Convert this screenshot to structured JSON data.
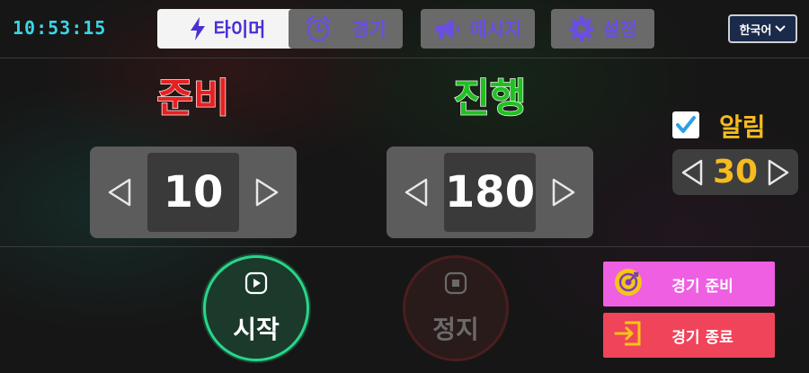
{
  "header": {
    "clock": "10:53:15",
    "tabs": [
      {
        "label": "타이머",
        "icon": "lightning-icon",
        "active": true
      },
      {
        "label": "경기",
        "icon": "stopwatch-icon",
        "active": false
      },
      {
        "label": "메시지",
        "icon": "megaphone-icon",
        "active": false
      },
      {
        "label": "설정",
        "icon": "gear-icon",
        "active": false
      }
    ],
    "language": "한국어"
  },
  "prep": {
    "title": "준비",
    "value": "10"
  },
  "run": {
    "title": "진행",
    "value": "180"
  },
  "alarm": {
    "label": "알림",
    "checked": true,
    "value": "30"
  },
  "controls": {
    "start_label": "시작",
    "stop_label": "정지"
  },
  "actions": {
    "ready_label": "경기 준비",
    "end_label": "경기 종료"
  },
  "colors": {
    "clock": "#3ad6e6",
    "prep_title": "#e82020",
    "run_title": "#20c020",
    "alarm": "#f5bb1f",
    "tab_text": "#4b2ed6",
    "start_ring": "#28d68a",
    "ready_button": "#ee5fe2",
    "end_button": "#f0445a"
  }
}
